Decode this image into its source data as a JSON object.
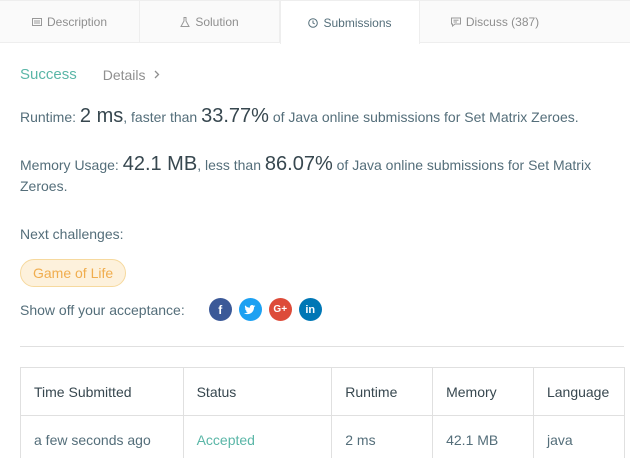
{
  "tabs": [
    {
      "label": "Description",
      "icon": "description-icon"
    },
    {
      "label": "Solution",
      "icon": "flask-icon"
    },
    {
      "label": "Submissions",
      "icon": "clock-icon"
    },
    {
      "label": "Discuss (387)",
      "icon": "comment-icon"
    }
  ],
  "result": {
    "status": "Success",
    "details_label": "Details"
  },
  "runtime": {
    "prefix": "Runtime:",
    "value": "2 ms",
    "mid": ", faster than",
    "percent": "33.77%",
    "suffix": "of Java online submissions for Set Matrix Zeroes."
  },
  "memory": {
    "prefix": "Memory Usage:",
    "value": "42.1 MB",
    "mid": ", less than",
    "percent": "86.07%",
    "suffix": "of Java online submissions for Set Matrix Zeroes."
  },
  "next": {
    "label": "Next challenges:",
    "challenge": "Game of Life"
  },
  "share": {
    "label": "Show off your acceptance:",
    "icons": [
      "facebook-icon",
      "twitter-icon",
      "google-plus-icon",
      "linkedin-icon"
    ]
  },
  "table": {
    "headers": [
      "Time Submitted",
      "Status",
      "Runtime",
      "Memory",
      "Language"
    ],
    "rows": [
      [
        "a few seconds ago",
        "Accepted",
        "2 ms",
        "42.1 MB",
        "java"
      ]
    ]
  },
  "colors": {
    "success": "#5ab6a7",
    "challenge_bg": "#fdf1dc",
    "challenge_text": "#f0ad4e",
    "facebook": "#3b5998",
    "twitter": "#1da1f2",
    "google": "#dd4b39",
    "linkedin": "#0077b5"
  }
}
